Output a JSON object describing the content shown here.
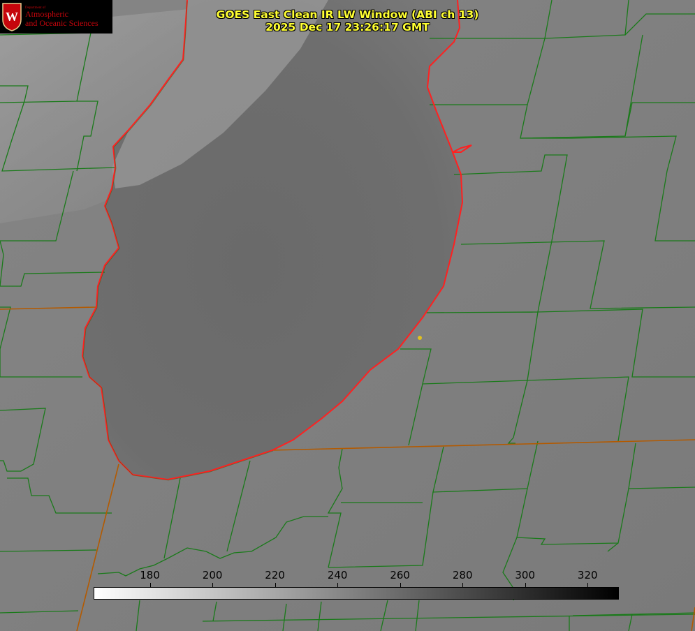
{
  "title": {
    "line1": "GOES East Clean IR LW Window (ABI ch 13)",
    "line2": "2025 Dec 17 23:26:17 GMT"
  },
  "logo": {
    "dept": "Department of",
    "line1": "Atmospheric",
    "line2": "and Oceanic Sciences",
    "crest_letter": "W",
    "colors": {
      "background": "#000000",
      "text": "#c5050c"
    }
  },
  "colorbar": {
    "min": 162,
    "max": 330,
    "ticks": [
      "180",
      "200",
      "220",
      "240",
      "260",
      "280",
      "300",
      "320"
    ],
    "tick_values": [
      180,
      200,
      220,
      240,
      260,
      280,
      300,
      320
    ],
    "gradient": [
      "#ffffff",
      "#000000"
    ]
  },
  "colors": {
    "county_lines": "#1a7a1a",
    "state_lines": "#b35a00",
    "coastline": "#ff2020",
    "marker": "#e0c020",
    "title": "#ffff33"
  },
  "icons": {
    "logo": "uw-crest-icon",
    "marker": "location-dot-icon"
  }
}
